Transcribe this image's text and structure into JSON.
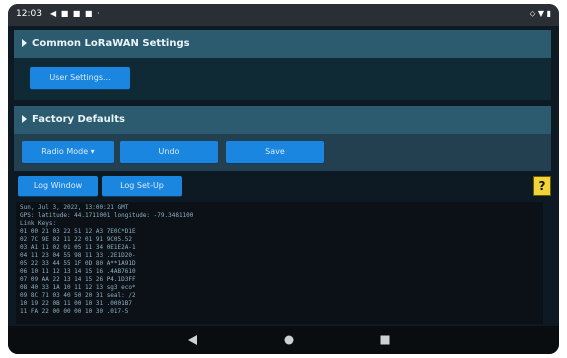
{
  "status_bar": {
    "time": "12:03",
    "left_icons": "◀ ■ ■ ■ ·",
    "right_icons": "⬦ ▼ ▮"
  },
  "common_panel": {
    "title": "Common LoRaWAN Settings",
    "button_label": "User Settings..."
  },
  "factory_panel": {
    "title": "Factory Defaults",
    "radio_label": "Radio Mode ▾",
    "undo_label": "Undo",
    "save_label": "Save"
  },
  "log_tabs": {
    "window_label": "Log Window",
    "setup_label": "Log Set-Up"
  },
  "help": "?",
  "log_lines": [
    "Sun, Jul 3, 2022, 13:00:21 GMT",
    "GPS: latitude: 44.1711001  longitude: -79.3481100",
    "Link Keys:",
    "01 00 21 03 22 51 12 A3       7E0C*D1E",
    "02 7C 9E 02 11 22 01 91       9C05.52",
    "03 A1 11 02 01 05 11 34       0E1E2A-1",
    "04 11 23 04 55 98 11 33       .2E1D20-",
    "05 22 33 44 55 1F 0D 80       A**1A91D",
    "06 10 11 12 13 14 15 16       .4AB7610",
    "07 09 AA 22 13 14 15 26       P4.1D3FF",
    "08 40 33 1A 10 11 12 13       sg3 eco*",
    "09 8C 71 03 40 50 20 31       seal: /2",
    "10 19 22 0B 11 00 10 31       .0001B7",
    "11 FA 22 00 00 00 10 30       .017-5"
  ]
}
